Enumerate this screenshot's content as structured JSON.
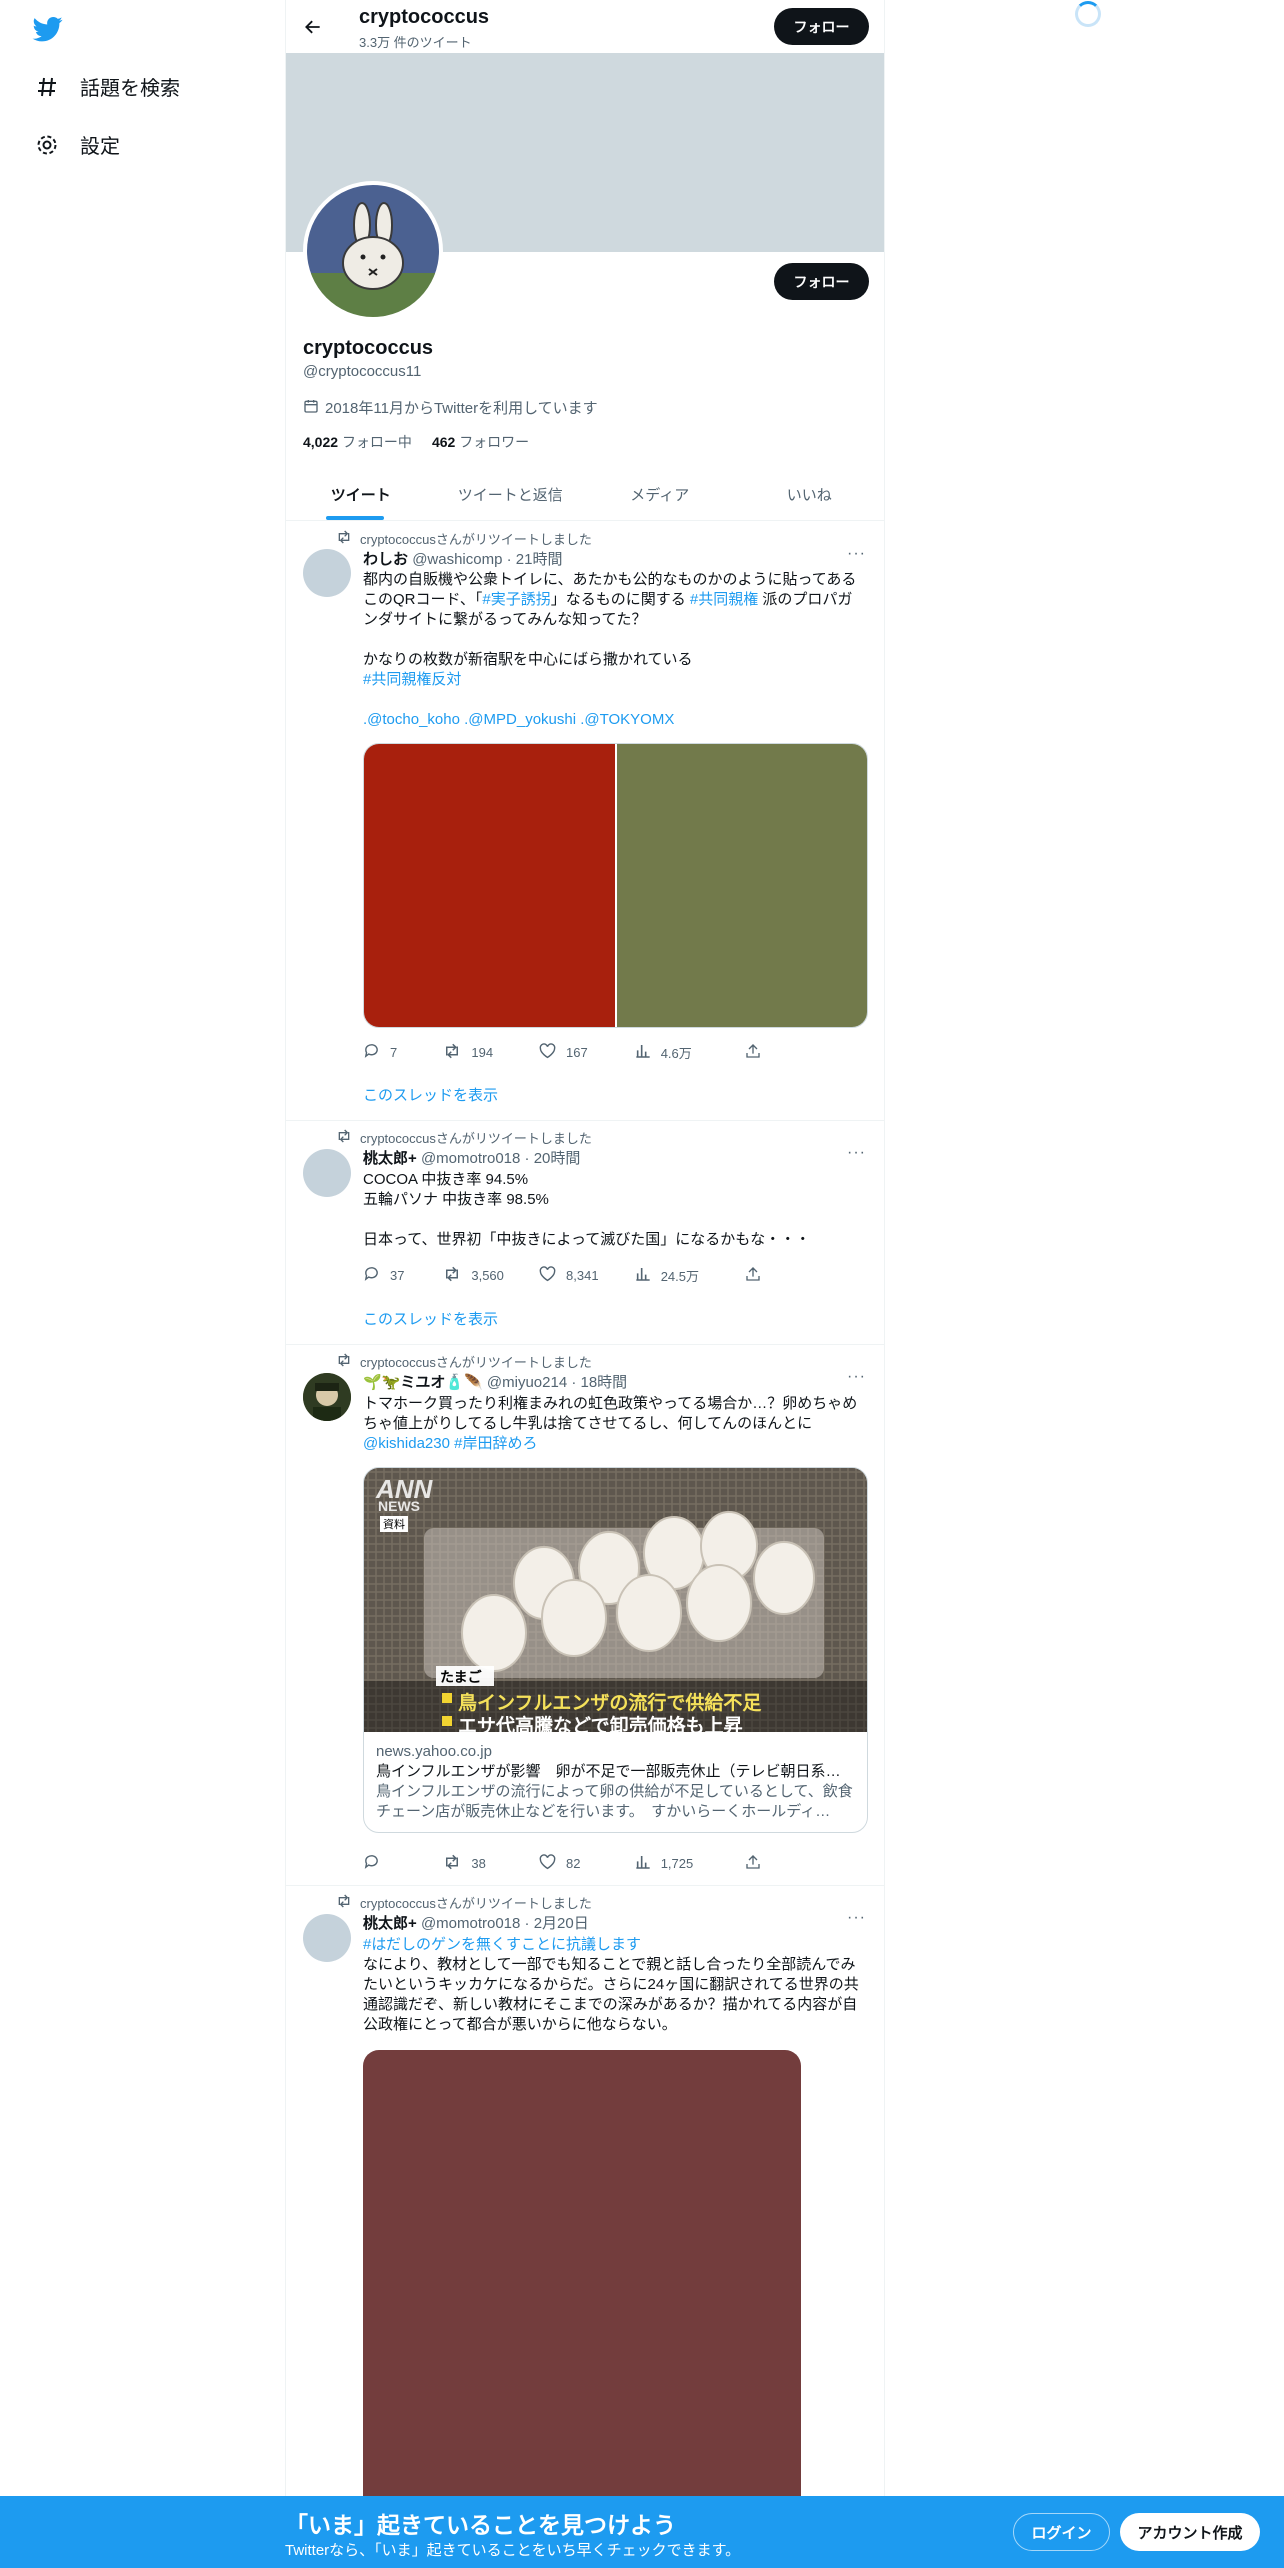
{
  "nav": {
    "explore_label": "話題を検索",
    "settings_label": "設定"
  },
  "header": {
    "name": "cryptococcus",
    "tweet_count": "3.3万 件のツイート",
    "follow_label": "フォロー"
  },
  "profile": {
    "follow_label": "フォロー",
    "name": "cryptococcus",
    "handle": "@cryptococcus11",
    "joined": "2018年11月からTwitterを利用しています",
    "following_count": "4,022",
    "following_label": "フォロー中",
    "followers_count": "462",
    "followers_label": "フォロワー"
  },
  "tabs": [
    "ツイート",
    "ツイートと返信",
    "メディア",
    "いいね"
  ],
  "tweets": [
    {
      "retweeted_by": "cryptococcusさんがリツイートしました",
      "name": "わしお",
      "meta": "@washicomp · 21時間",
      "lines": [
        "都内の自販機や公衆トイレに、あたかも公的なものかのように貼ってある",
        "このQRコード、「",
        "#実子誘拐",
        "」なるものに関する ",
        "#共同親権",
        " 派のプロパガ",
        "ンダサイトに繋がるってみんな知ってた？",
        "かなりの枚数が新宿駅を中心にばら撒かれている",
        "#共同親権反対",
        ".@tocho_koho .@MPD_yokushi .@TOKYOMX"
      ],
      "actions": {
        "reply": "7",
        "retweet": "194",
        "like": "167",
        "views": "4.6万"
      },
      "thread": "このスレッドを表示"
    },
    {
      "retweeted_by": "cryptococcusさんがリツイートしました",
      "name": "桃太郎+",
      "meta": "@momotro018 · 20時間",
      "lines": [
        "COCOA 中抜き率 94.5%",
        "五輪パソナ 中抜き率 98.5%",
        "日本って、世界初「中抜きによって滅びた国」になるかもな・・・"
      ],
      "actions": {
        "reply": "37",
        "retweet": "3,560",
        "like": "8,341",
        "views": "24.5万"
      },
      "thread": "このスレッドを表示"
    },
    {
      "retweeted_by": "cryptococcusさんがリツイートしました",
      "name": "🌱🦖ミユオ🧴🪶",
      "meta": "@miyuo214 · 18時間",
      "lines": [
        "トマホーク買ったり利権まみれの虹色政策やってる場合か…？卵めちゃめ",
        "ちゃ値上がりしてるし牛乳は捨てさせてるし、何してんのほんとに",
        "@kishida230",
        "#岸田辞めろ"
      ],
      "card": {
        "watermark_top": "ANN",
        "watermark_sub": "NEWS",
        "tag": "資料",
        "caption_tag": "たまご",
        "caption1": "鳥インフルエンザの流行で供給不足",
        "caption2": "エサ代高騰などで卸売価格も上昇",
        "domain": "news.yahoo.co.jp",
        "title": "鳥インフルエンザが影響　卵が不足で一部販売休止（テレビ朝日系（…",
        "desc1": "鳥インフルエンザの流行によって卵の供給が不足しているとして、飲食",
        "desc2": "チェーン店が販売休止などを行います。　すかいらーくホールディ…"
      },
      "actions": {
        "reply": "",
        "retweet": "38",
        "like": "82",
        "views": "1,725"
      }
    },
    {
      "retweeted_by": "cryptococcusさんがリツイートしました",
      "name": "桃太郎+",
      "meta": "@momotro018 · 2月20日",
      "lines": [
        "#はだしのゲンを無くすことに抗議します",
        "なにより、教材として一部でも知ることで親と話し合ったり全部読んでみ",
        "たいというキッカケになるからだ。さらに24ヶ国に翻訳されてる世界の共",
        "通認識だぞ、新しい教材にそこまでの深みがあるか？描かれてる内容が自",
        "公政権にとって都合が悪いからに他ならない。"
      ]
    }
  ],
  "bottom": {
    "title": "「いま」起きていることを見つけよう",
    "subtitle": "Twitterなら、「いま」起きていることをいち早くチェックできます。",
    "login": "ログイン",
    "signup": "アカウント作成"
  },
  "colors": {
    "accent": "#1d9bf0",
    "media_red": "#a8200d",
    "media_olive": "#727a4b",
    "media_maroon": "#733d3d"
  }
}
